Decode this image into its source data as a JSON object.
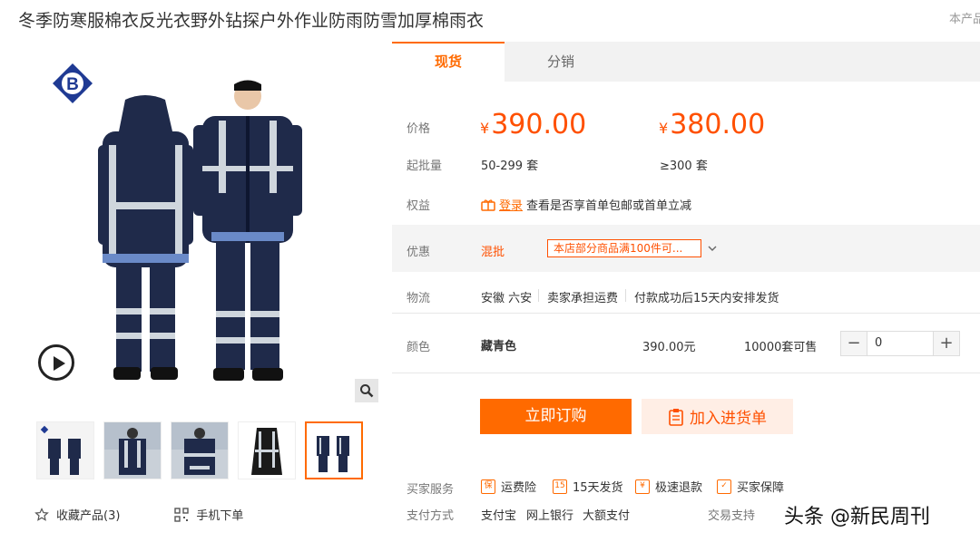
{
  "product": {
    "title": "冬季防寒服棉衣反光衣野外钻探户外作业防雨防雪加厚棉雨衣",
    "corner_text": "本产品"
  },
  "tabs": [
    {
      "label": "现货",
      "active": true
    },
    {
      "label": "分销",
      "active": false
    }
  ],
  "pricing": {
    "label": "价格",
    "currency": "¥",
    "tiers": [
      {
        "price": "390.00",
        "quantity": "50-299 套"
      },
      {
        "price": "380.00",
        "quantity": "≥300 套"
      }
    ],
    "moq_label": "起批量"
  },
  "benefits": {
    "label": "权益",
    "login_link": "登录",
    "text": "查看是否享首单包邮或首单立减"
  },
  "promotion": {
    "label": "优惠",
    "type": "混批",
    "text": "本店部分商品满100件可..."
  },
  "logistics": {
    "label": "物流",
    "origin": "安徽 六安",
    "shipping_fee": "卖家承担运费",
    "delivery": "付款成功后15天内安排发货"
  },
  "variant": {
    "label": "颜色",
    "name": "藏青色",
    "price": "390.00元",
    "stock": "10000套可售",
    "quantity": "0",
    "minus": "−",
    "plus": "+"
  },
  "actions": {
    "order": "立即订购",
    "cart": "加入进货单"
  },
  "services": {
    "label": "买家服务",
    "items": [
      "运费险",
      "15天发货",
      "极速退款",
      "买家保障"
    ]
  },
  "payment": {
    "label": "支付方式",
    "methods": [
      "支付宝",
      "网上银行",
      "大额支付"
    ],
    "trade_label": "交易支持"
  },
  "gallery": {
    "favorite": "收藏产品(3)",
    "mobile_order": "手机下单",
    "thumbnail_count": 5,
    "active_thumbnail": 5
  },
  "watermark": "头条 @新民周刊",
  "colors": {
    "accent": "#ff6a00",
    "price": "#ff5000",
    "jacket": "#1f2a4a"
  }
}
